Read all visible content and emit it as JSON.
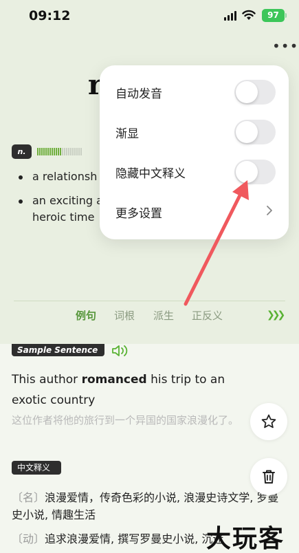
{
  "status": {
    "time": "09:12",
    "battery": "97"
  },
  "word": {
    "headword_visible": "r",
    "pos": "n."
  },
  "definitions": [
    "a relationsh",
    "an exciting a",
    "heroic time"
  ],
  "tabs": {
    "items": [
      "例句",
      "词根",
      "派生",
      "正反义"
    ],
    "active_index": 0
  },
  "sample": {
    "label": "Sample Sentence",
    "en_before": "This author ",
    "en_bold": "romanced",
    "en_after": " his trip to an exotic country",
    "cn": "这位作者将他的旅行到一个异国的国家浪漫化了。"
  },
  "cn_meaning": {
    "label": "中文释义",
    "entries": [
      {
        "pos": "〔名〕",
        "text": "浪漫爱情，传奇色彩的小说, 浪漫史诗文学, 罗曼史小说, 情趣生活"
      },
      {
        "pos": "〔动〕",
        "text": "追求浪漫爱情, 撰写罗曼史小说, 沉迷"
      }
    ]
  },
  "menu": {
    "items": [
      {
        "label": "自动发音",
        "type": "toggle",
        "on": false
      },
      {
        "label": "渐显",
        "type": "toggle",
        "on": false
      },
      {
        "label": "隐藏中文释义",
        "type": "toggle",
        "on": false
      },
      {
        "label": "更多设置",
        "type": "link"
      }
    ]
  },
  "watermark": "大玩客",
  "colors": {
    "accent_green": "#56963a",
    "arrow_red": "#f0595e",
    "toggle_off": "#e9e9eb"
  },
  "icons": [
    "signal-icon",
    "wifi-icon",
    "battery-icon",
    "more-icon",
    "speaker-icon",
    "star-icon",
    "trash-icon",
    "chevron-right-icon",
    "arrow-annotation"
  ],
  "frequency_level": 0.55
}
